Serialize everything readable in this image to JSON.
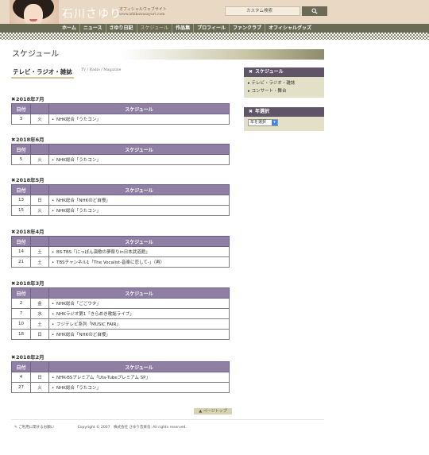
{
  "header": {
    "brand_name": "石川さゆり",
    "brand_subtitle": "オフィシャルウェブサイト",
    "brand_url": "www.ishikawasayuri.com",
    "search_placeholder": "カスタム検索"
  },
  "nav": {
    "items": [
      {
        "label": "ホーム",
        "active": false
      },
      {
        "label": "ニュース",
        "active": false
      },
      {
        "label": "さゆり日記",
        "active": false
      },
      {
        "label": "スケジュール",
        "active": true
      },
      {
        "label": "作品集",
        "active": false
      },
      {
        "label": "プロフィール",
        "active": false
      },
      {
        "label": "ファンクラブ",
        "active": false
      },
      {
        "label": "オフィシャルグッズ",
        "active": false
      }
    ]
  },
  "page": {
    "title": "スケジュール",
    "category_title": "テレビ・ラジオ・雑誌",
    "category_en": "TV / Radio / Magazine"
  },
  "table_headers": {
    "date": "日付",
    "day": "",
    "schedule": "スケジュール"
  },
  "months": [
    {
      "title": "2018年7月",
      "rows": [
        {
          "date": "3",
          "day": "火",
          "text": "NHK総合「うたコン」"
        }
      ]
    },
    {
      "title": "2018年6月",
      "rows": [
        {
          "date": "5",
          "day": "火",
          "text": "NHK総合「うたコン」"
        }
      ]
    },
    {
      "title": "2018年5月",
      "rows": [
        {
          "date": "13",
          "day": "日",
          "text": "NHK総合「NHKのど自慢」"
        },
        {
          "date": "15",
          "day": "火",
          "text": "NHK総合「うたコン」"
        }
      ]
    },
    {
      "title": "2018年4月",
      "rows": [
        {
          "date": "14",
          "day": "土",
          "text": "BS-TBS「にっぽん演歌の夢祭りin日本武道館」"
        },
        {
          "date": "21",
          "day": "土",
          "text": "TBSチャンネル1「The Vocalist-音楽に恋して-」（再）"
        }
      ]
    },
    {
      "title": "2018年3月",
      "rows": [
        {
          "date": "2",
          "day": "金",
          "text": "NHK総合「ごごウタ」"
        },
        {
          "date": "7",
          "day": "水",
          "text": "NHKラジオ第1「きらめき歌謡ライブ」"
        },
        {
          "date": "10",
          "day": "土",
          "text": "フジテレビ系列「MUSIC FAIR」"
        },
        {
          "date": "18",
          "day": "日",
          "text": "NHK総合「NHKのど自慢」"
        }
      ]
    },
    {
      "title": "2018年2月",
      "rows": [
        {
          "date": "4",
          "day": "日",
          "text": "NHK-BSプレミアム「Uta-Tubeプレミアム SP」"
        },
        {
          "date": "27",
          "day": "火",
          "text": "NHK総合「うたコン」"
        }
      ]
    }
  ],
  "sidebar": {
    "schedule_head": "スケジュール",
    "schedule_links": [
      "テレビ・ラジオ・雑誌",
      "コンサート・舞台"
    ],
    "year_head": "年選択",
    "year_select_value": "年を選択"
  },
  "footer": {
    "page_top": "▲ ページトップ",
    "contact": "ご利用に関するお願い",
    "copyright": "Copyright © 2007　株式会社 さゆり音楽舎. All rights reserved."
  },
  "colors": {
    "header_bg": "#e9d8c3",
    "nav_bg": "#6b6b55",
    "table_header": "#8e7fa3",
    "sidebar_head": "#5f5468",
    "sidebar_body": "#e3e0c8"
  }
}
